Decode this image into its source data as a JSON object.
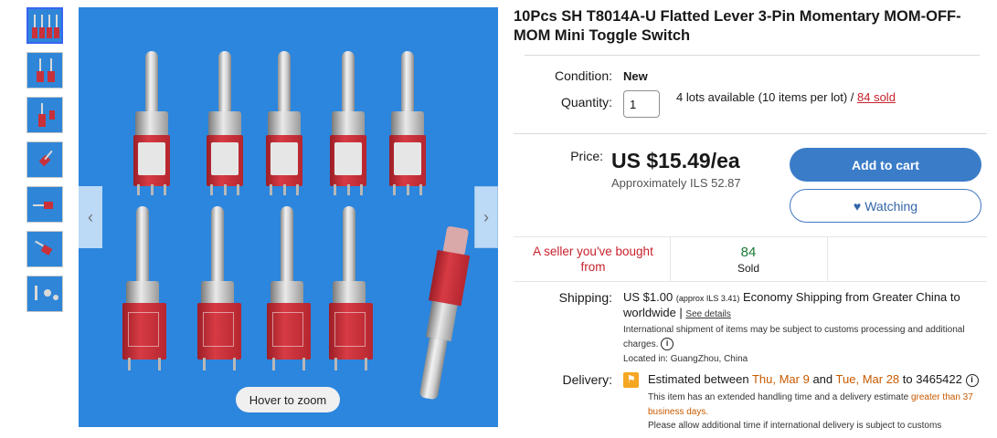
{
  "gallery": {
    "hover_zoom": "Hover to zoom",
    "prev_arrow": "‹",
    "next_arrow": "›",
    "thumb_count": 7
  },
  "product": {
    "title": "10Pcs SH T8014A-U Flatted Lever 3-Pin Momentary MOM-OFF-MOM Mini Toggle Switch"
  },
  "condition": {
    "label": "Condition:",
    "value": "New"
  },
  "quantity": {
    "label": "Quantity:",
    "value": "1",
    "availability": "4 lots available (10 items per lot) /",
    "sold_link": "84 sold"
  },
  "price": {
    "label": "Price:",
    "value": "US $15.49/ea",
    "approx": "Approximately ILS 52.87"
  },
  "buttons": {
    "add_to_cart": "Add to cart",
    "watching": "Watching",
    "heart_icon": "♥"
  },
  "stats": {
    "seller_note": "A seller you've bought from",
    "sold_count": "84",
    "sold_label": "Sold"
  },
  "shipping": {
    "label": "Shipping:",
    "cost": "US $1.00",
    "approx": "(approx ILS 3.41)",
    "method": "Economy Shipping from Greater China to worldwide |",
    "details_link": "See details",
    "customs_note": "International shipment of items may be subject to customs processing and additional charges.",
    "location": "Located in: GuangZhou, China"
  },
  "delivery": {
    "label": "Delivery:",
    "estimated_prefix": "Estimated between",
    "date_start": "Thu, Mar 9",
    "and": "and",
    "date_end": "Tue, Mar 28",
    "to": "to",
    "zip": "3465422",
    "handling_note": "This item has an extended handling time and a delivery estimate",
    "handling_highlight": "greater than 37 business days.",
    "customs_note": "Please allow additional time if international delivery is subject to customs"
  },
  "colors": {
    "accent_blue": "#3a7cc8",
    "sold_green": "#1c7a34",
    "seller_red": "#c7222c",
    "date_orange": "#c85a00"
  }
}
